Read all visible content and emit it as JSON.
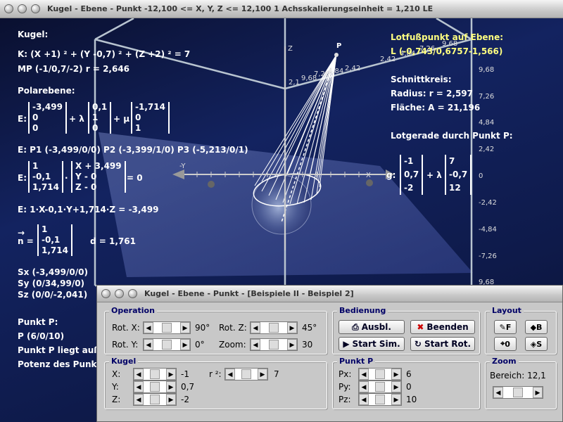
{
  "window": {
    "title": "Kugel - Ebene - Punkt   -12,100 <= X, Y, Z <= 12,100    1 Achsskalierungseinheit = 1,210 LE"
  },
  "left_text": {
    "kugel_heading": "Kugel:",
    "kugel_eq": "K: (X +1) ² + (Y -0,7) ² + (Z +2) ² = 7",
    "mp": "MP (-1/0,7/-2)   r = 2,646",
    "polarebene_heading": "Polarebene:",
    "e_label": "E:",
    "e_vec1": [
      "-3,499",
      "0",
      "0"
    ],
    "e_vec2": [
      "0,1",
      "1",
      "0"
    ],
    "e_vec3": [
      "-1,714",
      "0",
      "1"
    ],
    "plus_lambda": "+ λ",
    "plus_mu": "+ μ",
    "points": "E: P1 (-3,499/0/0)    P2 (-3,399/1/0)    P3 (-5,213/0/1)",
    "normal_vec": [
      "1",
      "-0,1",
      "1,714"
    ],
    "xyz_vec": [
      "X + 3,499",
      "Y - 0",
      "Z - 0"
    ],
    "dot": "·",
    "eq_zero": "= 0",
    "coord_form": "E: 1·X-0,1·Y+1,714·Z = -3,499",
    "n_arrow": "→",
    "n_label": "n =",
    "n_vec": [
      "1",
      "-0,1",
      "1,714"
    ],
    "d_value": "d = 1,761",
    "sx": "Sx (-3,499/0/0)",
    "sy": "Sy (0/34,99/0)",
    "sz": "Sz (0/0/-2,041)",
    "punkt_heading": "Punkt P:",
    "punkt_p": "P (6/0/10)",
    "punkt_liegt": "Punkt P liegt auß",
    "potenz": "Potenz des Punk"
  },
  "right_text": {
    "lotfuss_heading": "Lotfußpunkt auf Ebene:",
    "lotfuss": "L (-0,743/0,6757-1,566)",
    "schnittkreis": "Schnittkreis:",
    "radius": "Radius: r = 2,597",
    "flaeche": "Fläche: A = 21,196",
    "lotgerade": "Lotgerade durch Punkt P:",
    "g_label": "g:",
    "g_vec1": [
      "-1",
      "0,7",
      "-2"
    ],
    "g_lambda": "+ λ",
    "g_vec2": [
      "7",
      "-0,7",
      "12"
    ]
  },
  "axis": {
    "z_label": "Z",
    "y_label": "-Y",
    "x_label": "X",
    "p_label": "P",
    "ticks_right": [
      "9,68",
      "7,26",
      "4,84",
      "2,42",
      "0",
      "-2,42",
      "-4,84",
      "-7,26",
      "9,68"
    ],
    "ticks_top": [
      "9,68",
      "7,26",
      "4,84",
      "2,42",
      "2,42",
      "4,84",
      "7,26",
      "9,68",
      "2,1"
    ]
  },
  "dialog": {
    "title": "Kugel - Ebene - Punkt - [Beispiele II - Beispiel 2]",
    "operation": {
      "heading": "Operation",
      "rot_x_label": "Rot. X:",
      "rot_x_value": "90°",
      "rot_y_label": "Rot. Y:",
      "rot_y_value": "0°",
      "rot_z_label": "Rot. Z:",
      "rot_z_value": "45°",
      "zoom_label": "Zoom:",
      "zoom_value": "30"
    },
    "bedienung": {
      "heading": "Bedienung",
      "ausbl": "Ausbl.",
      "beenden": "Beenden",
      "start_sim": "Start Sim.",
      "start_rot": "Start Rot."
    },
    "layout": {
      "heading": "Layout",
      "f": "F",
      "b": "B",
      "o": "0",
      "s": "S"
    },
    "kugel": {
      "heading": "Kugel",
      "x_label": "X:",
      "x_value": "-1",
      "y_label": "Y:",
      "y_value": "0,7",
      "z_label": "Z:",
      "z_value": "-2",
      "r2_label": "r ²:",
      "r2_value": "7"
    },
    "punkt": {
      "heading": "Punkt P",
      "px_label": "Px:",
      "px_value": "6",
      "py_label": "Py:",
      "py_value": "0",
      "pz_label": "Pz:",
      "pz_value": "10"
    },
    "zoom": {
      "heading": "Zoom",
      "bereich": "Bereich:  12,1"
    }
  },
  "colors": {
    "highlight_text": "#ffff80",
    "background": "#132360",
    "group_heading": "#000066"
  }
}
